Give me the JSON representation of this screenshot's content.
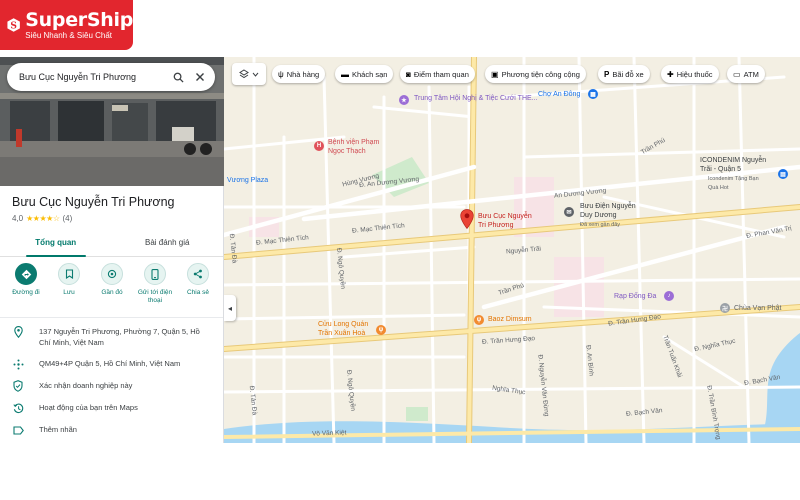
{
  "brand": {
    "name": "SuperShip",
    "tagline": "Siêu Nhanh & Siêu Chất",
    "color": "#e2262e"
  },
  "panel": {
    "search_value": "Bưu Cục Nguyễn Tri Phương",
    "search_icon": "search-icon",
    "close_icon": "close-icon",
    "place_name": "Bưu Cục Nguyễn Tri Phương",
    "rating_value": "4,0",
    "rating_stars": "★★★★☆",
    "rating_count": "(4)",
    "tabs": [
      {
        "label": "Tổng quan",
        "active": true
      },
      {
        "label": "Bài đánh giá",
        "active": false
      }
    ],
    "actions": [
      {
        "label": "Đường đi",
        "icon": "directions-icon"
      },
      {
        "label": "Lưu",
        "icon": "bookmark-icon"
      },
      {
        "label": "Gần đó",
        "icon": "nearby-icon"
      },
      {
        "label": "Gửi tới điện thoại",
        "icon": "send-to-phone-icon"
      },
      {
        "label": "Chia sẻ",
        "icon": "share-icon"
      }
    ],
    "info": [
      {
        "text": "137 Nguyễn Tri Phương, Phường 7, Quận 5, Hồ Chí Minh, Việt Nam",
        "icon": "location-pin-icon"
      },
      {
        "text": "QM49+4P Quận 5, Hồ Chí Minh, Việt Nam",
        "icon": "plus-code-icon"
      },
      {
        "text": "Xác nhận doanh nghiệp này",
        "icon": "verified-shield-icon"
      },
      {
        "text": "Hoạt động của bạn trên Maps",
        "icon": "history-icon"
      },
      {
        "text": "Thêm nhãn",
        "icon": "label-icon"
      }
    ],
    "accent": "#0b7b70"
  },
  "map": {
    "chips": [
      {
        "label": "Nhà hàng",
        "icon": "restaurant-icon"
      },
      {
        "label": "Khách sạn",
        "icon": "hotel-icon"
      },
      {
        "label": "Điểm tham quan",
        "icon": "camera-icon"
      },
      {
        "label": "Phương tiện công cộng",
        "icon": "transit-icon"
      },
      {
        "label": "Bãi đỗ xe",
        "icon": "parking-icon"
      },
      {
        "label": "Hiệu thuốc",
        "icon": "pharmacy-icon"
      },
      {
        "label": "ATM",
        "icon": "atm-icon"
      }
    ],
    "roads": {
      "hung_vuong": "Hùng Vương",
      "an_duong_vuong_1": "Đ. An Dương Vương",
      "an_duong_vuong_2": "An Dương Vương",
      "mac_thien_tich_1": "Đ. Mạc Thiên Tích",
      "mac_thien_tich_2": "Đ. Mạc Thiên Tích",
      "nguyen_trai": "Nguyễn Trãi",
      "tran_phu_1": "Trần Phú",
      "tran_phu_2": "Trần Phú",
      "tran_hung_dao_1": "Đ. Trần Hưng Đạo",
      "tran_hung_dao_2": "Đ. Trần Hưng Đạo",
      "ngo_quyen_1": "Đ. Ngô Quyền",
      "ngo_quyen_2": "Đ. Ngô Quyền",
      "nguyen_van_dung": "Đ. Nguyễn Văn Đừng",
      "nghia_thuc_1": "Nghĩa Thục",
      "nghia_thuc_2": "Đ. Nghĩa Thục",
      "vo_van_kiet": "Võ Văn Kiệt",
      "bach_van_1": "Đ. Bạch Vân",
      "bach_van_2": "Đ. Bạch Vân",
      "phan_van_tri": "Đ. Phan Văn Trị",
      "tan_da": "Đ. Tản Đà",
      "tan_da_2": "Đ. Tản Đà",
      "an_binh": "Đ. An Bình",
      "tran_tuan_khai": "Trần Tuấn Khải",
      "tran_binh_trong": "Đ. Trần Bình Trọng"
    },
    "pois": {
      "main": "Bưu Cục Nguyễn Tri Phương",
      "conference": "Trung Tâm Hội Nghị & Tiệc Cưới THE...",
      "hospital": "Bệnh viện Phạm Ngọc Thạch",
      "market": "Chợ An Đông",
      "plaza": "Vương Plaza",
      "post_office_2": "Bưu Điện Nguyễn Duy Dương",
      "post_office_2_sub": "Đã xem gần đây",
      "icondenim": "ICONDENIM Nguyễn Trãi - Quận 5",
      "icondenim_sub": "Icondenim Tặng Bạn Quà Hot",
      "cinema": "Rạp Đống Đa",
      "pagoda": "Chùa Vạn Phật",
      "seafood": "Cửu Long Quán Trần Xuân Hoà",
      "baoz": "Baoz Dimsum"
    },
    "colors": {
      "land": "#f3efe3",
      "road": "#ffffff",
      "major_road": "#fde9a8",
      "park": "#cfeacc",
      "water": "#a7d6f3",
      "pin": "#ea4335"
    }
  }
}
